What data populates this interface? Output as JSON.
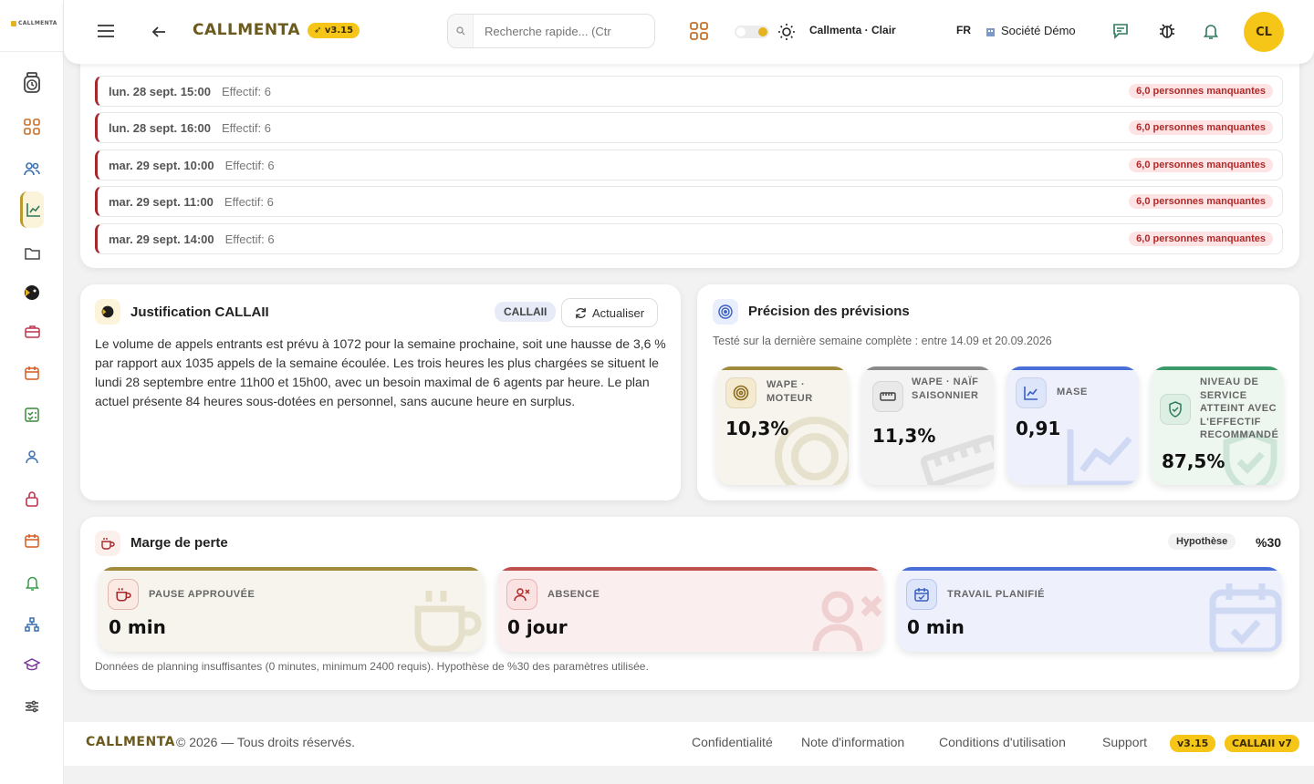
{
  "sidebar": {
    "logo_text": "CALLMENTA",
    "items": [
      {
        "name": "timer",
        "icon": "stopwatch-icon"
      },
      {
        "name": "dashboard",
        "icon": "grid-icon"
      },
      {
        "name": "team",
        "icon": "users-icon"
      },
      {
        "name": "analytics",
        "icon": "chart-line-icon",
        "active": true
      },
      {
        "name": "files",
        "icon": "folder-icon"
      },
      {
        "name": "ai",
        "icon": "ai-head-icon"
      },
      {
        "name": "jobs",
        "icon": "briefcase-icon"
      },
      {
        "name": "calendar",
        "icon": "calendar-icon"
      },
      {
        "name": "checklist",
        "icon": "checklist-icon"
      },
      {
        "name": "user",
        "icon": "user-icon"
      },
      {
        "name": "lock",
        "icon": "lock-icon"
      },
      {
        "name": "schedule",
        "icon": "calendar-2-icon"
      },
      {
        "name": "notifications",
        "icon": "bell-icon"
      },
      {
        "name": "org",
        "icon": "org-chart-icon"
      },
      {
        "name": "training",
        "icon": "graduation-cap-icon"
      },
      {
        "name": "settings",
        "icon": "sliders-icon"
      }
    ]
  },
  "header": {
    "brand": "CALLMENTA",
    "version": "v3.15",
    "search_placeholder": "Recherche rapide... (Ctr",
    "theme_label": "Callmenta · Clair",
    "language": "FR",
    "company": "Société Démo",
    "avatar_initials": "CL"
  },
  "shortage_rows": [
    {
      "time": "lun. 28 sept. 15:00",
      "effectif": "Effectif: 6",
      "badge": "6,0 personnes manquantes"
    },
    {
      "time": "lun. 28 sept. 16:00",
      "effectif": "Effectif: 6",
      "badge": "6,0 personnes manquantes"
    },
    {
      "time": "mar. 29 sept. 10:00",
      "effectif": "Effectif: 6",
      "badge": "6,0 personnes manquantes"
    },
    {
      "time": "mar. 29 sept. 11:00",
      "effectif": "Effectif: 6",
      "badge": "6,0 personnes manquantes"
    },
    {
      "time": "mar. 29 sept. 14:00",
      "effectif": "Effectif: 6",
      "badge": "6,0 personnes manquantes"
    }
  ],
  "justification": {
    "title": "Justification CALLAII",
    "tag": "CALLAII",
    "refresh_label": "Actualiser",
    "text": "Le volume de appels entrants est prévu à 1072 pour la semaine prochaine, soit une hausse de 3,6 % par rapport aux 1035 appels de la semaine écoulée. Les trois heures les plus chargées se situent le lundi 28 septembre entre 11h00 et 15h00, avec un besoin maximal de 6 agents par heure. Le plan actuel présente 84 heures sous-dotées en personnel, sans aucune heure en surplus."
  },
  "precision": {
    "title": "Précision des prévisions",
    "subtitle": "Testé sur la dernière semaine complète : entre 14.09 et 20.09.2026",
    "metrics": [
      {
        "label": "WAPE · MOTEUR",
        "value": "10,3%",
        "icon": "target-icon",
        "color": "#a08a3c"
      },
      {
        "label": "WAPE · NAÏF SAISONNIER",
        "value": "11,3%",
        "icon": "ruler-icon",
        "color": "#8a8a8a"
      },
      {
        "label": "MASE",
        "value": "0,91",
        "icon": "chart-line-icon",
        "color": "#4a6fd8"
      },
      {
        "label": "NIVEAU DE SERVICE ATTEINT AVEC L'EFFECTIF RECOMMANDÉ",
        "value": "87,5%",
        "icon": "shield-check-icon",
        "color": "#3a9a6a"
      }
    ]
  },
  "loss_margin": {
    "title": "Marge de perte",
    "hypothesis_label": "Hypothèse",
    "hypothesis_value": "%30",
    "items": [
      {
        "label": "PAUSE APPROUVÉE",
        "value": "0 min",
        "icon": "coffee-icon",
        "color": "#a08a3c"
      },
      {
        "label": "ABSENCE",
        "value": "0 jour",
        "icon": "user-x-icon",
        "color": "#c0504d"
      },
      {
        "label": "TRAVAIL PLANIFIÉ",
        "value": "0 min",
        "icon": "calendar-check-icon",
        "color": "#4a6fd8"
      }
    ],
    "note": "Données de planning insuffisantes (0 minutes, minimum 2400 requis). Hypothèse de %30 des paramètres utilisée."
  },
  "footer": {
    "brand": "CALLMENTA",
    "copyright": "© 2026 — Tous droits réservés.",
    "links": [
      "Confidentialité",
      "Note d'information",
      "Conditions d'utilisation",
      "Support"
    ],
    "badge_version": "v3.15",
    "badge_ai": "CALLAII v7"
  }
}
